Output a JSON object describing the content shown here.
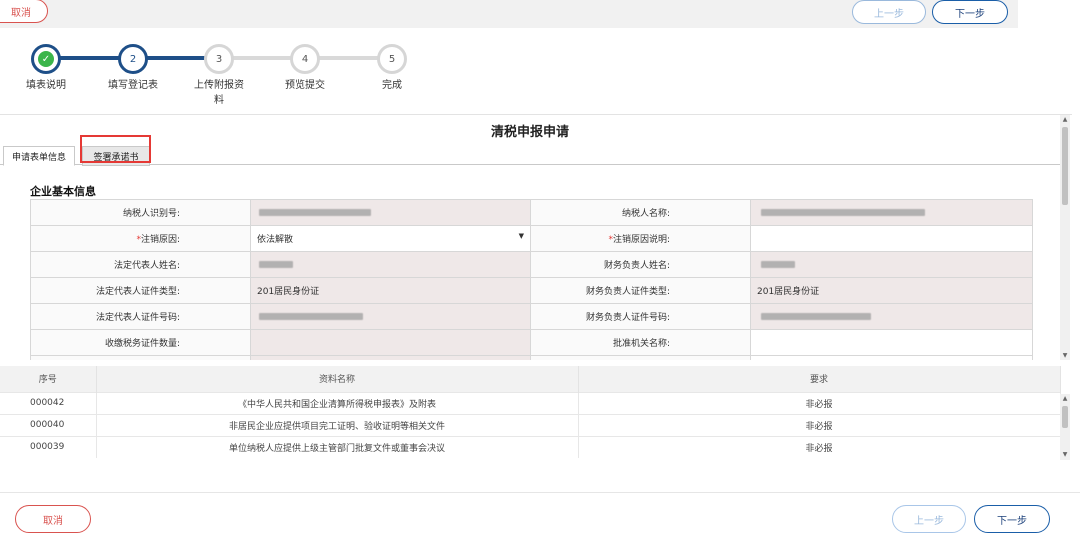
{
  "topbar": {
    "cancel_label": "取消",
    "prev_label": "上一步",
    "next_label": "下一步"
  },
  "stepper": {
    "steps": [
      {
        "number": "1",
        "label": "填表说明",
        "state": "done"
      },
      {
        "number": "2",
        "label": "填写登记表",
        "state": "active"
      },
      {
        "number": "3",
        "label": "上传附报资料",
        "state": "todo"
      },
      {
        "number": "4",
        "label": "预览提交",
        "state": "todo"
      },
      {
        "number": "5",
        "label": "完成",
        "state": "todo"
      }
    ]
  },
  "form": {
    "title": "清税申报申请",
    "tabs": [
      {
        "label": "申请表单信息",
        "active": true
      },
      {
        "label": "签署承诺书",
        "active": false
      }
    ],
    "section_title": "企业基本信息",
    "rows": [
      {
        "left_label": "纳税人识别号:",
        "left_value": "",
        "left_required": false,
        "right_label": "纳税人名称:",
        "right_value": "",
        "right_required": false
      },
      {
        "left_label": "注销原因:",
        "left_value": "依法解散",
        "left_required": true,
        "right_label": "注销原因说明:",
        "right_value": "",
        "right_required": true
      },
      {
        "left_label": "法定代表人姓名:",
        "left_value": "",
        "left_required": false,
        "right_label": "财务负责人姓名:",
        "right_value": "",
        "right_required": false
      },
      {
        "left_label": "法定代表人证件类型:",
        "left_value": "201居民身份证",
        "left_required": false,
        "right_label": "财务负责人证件类型:",
        "right_value": "201居民身份证",
        "right_required": false
      },
      {
        "left_label": "法定代表人证件号码:",
        "left_value": "",
        "left_required": false,
        "right_label": "财务负责人证件号码:",
        "right_value": "",
        "right_required": false
      },
      {
        "left_label": "收缴税务证件数量:",
        "left_value": "",
        "left_required": false,
        "right_label": "批准机关名称:",
        "right_value": "",
        "right_required": false
      }
    ],
    "required_mark": "*"
  },
  "attachments": {
    "headers": {
      "seq": "序号",
      "name": "资料名称",
      "requirement": "要求"
    },
    "rows": [
      {
        "seq": "000042",
        "name": "《中华人民共和国企业清算所得税申报表》及附表",
        "requirement": "非必报"
      },
      {
        "seq": "000040",
        "name": "非居民企业应提供项目完工证明、验收证明等相关文件",
        "requirement": "非必报"
      },
      {
        "seq": "000039",
        "name": "单位纳税人应提供上级主管部门批复文件或董事会决议",
        "requirement": "非必报"
      }
    ]
  },
  "bottom": {
    "cancel_label": "取消",
    "prev_label": "上一步",
    "next_label": "下一步"
  },
  "colors": {
    "brand": "#1e4f88",
    "success": "#3bb54a",
    "danger": "#d9534f",
    "highlight": "#e53935"
  }
}
